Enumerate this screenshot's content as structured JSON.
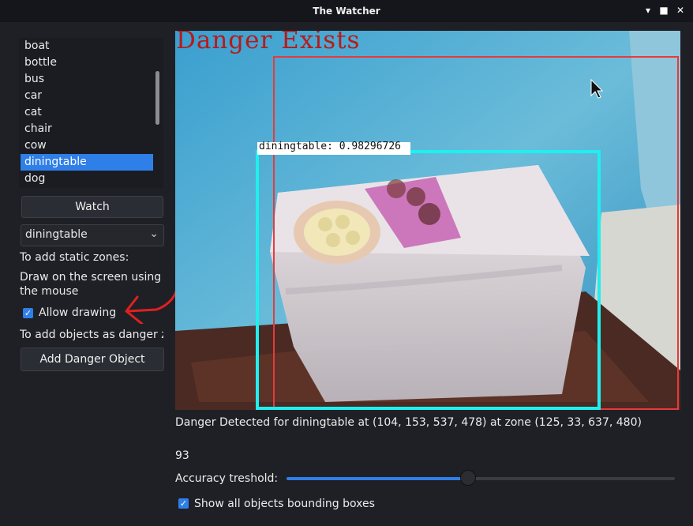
{
  "window": {
    "title": "The Watcher",
    "controls": [
      "minimize-icon",
      "maximize-icon",
      "close-icon"
    ]
  },
  "sidebar": {
    "classes": [
      "boat",
      "bottle",
      "bus",
      "car",
      "cat",
      "chair",
      "cow",
      "diningtable",
      "dog"
    ],
    "selected_class": "diningtable",
    "watch_label": "Watch",
    "combo_value": "diningtable",
    "static_zones_heading": "To add static zones:",
    "draw_hint_line1": "Draw on the screen using",
    "draw_hint_line2": "the mouse",
    "allow_drawing_label": "Allow drawing",
    "allow_drawing_checked": true,
    "danger_objects_hint": "To add objects as danger zo",
    "add_danger_label": "Add Danger Object"
  },
  "video": {
    "overlay_text": "Danger Exists",
    "detection_label": "diningtable: 0.98296726",
    "zone_color": "#e83a3a",
    "detection_color": "#1ef0f0"
  },
  "status": {
    "detection_message": "Danger Detected for diningtable at (104, 153, 537, 478) at zone (125, 33, 637, 480)",
    "accuracy_value": "93",
    "accuracy_label": "Accuracy treshold:",
    "accuracy_fraction": 0.93,
    "show_boxes_label": "Show all objects bounding boxes",
    "show_boxes_checked": true
  },
  "colors": {
    "accent": "#2f7fe8",
    "background": "#1f2026"
  }
}
